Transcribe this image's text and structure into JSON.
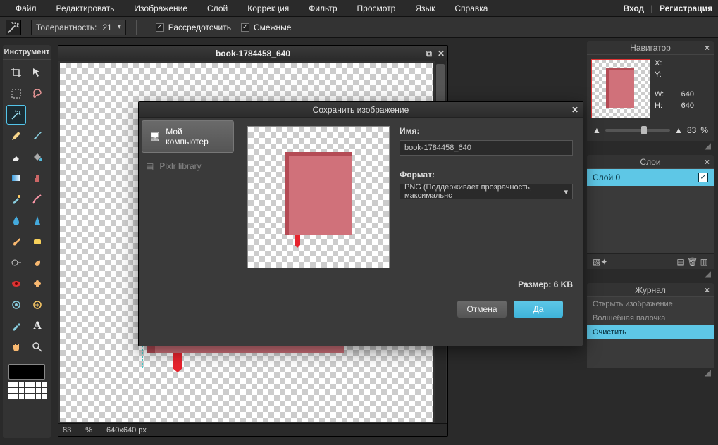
{
  "menu": {
    "items": [
      "Файл",
      "Редактировать",
      "Изображение",
      "Слой",
      "Коррекция",
      "Фильтр",
      "Просмотр",
      "Язык",
      "Справка"
    ],
    "login": "Вход",
    "register": "Регистрация"
  },
  "options": {
    "tolerance_label": "Толерантность:",
    "tolerance_value": "21",
    "anti_alias_label": "Рассредоточить",
    "contiguous_label": "Смежные"
  },
  "toolbox_title": "Инструмент",
  "document": {
    "title": "book-1784458_640",
    "zoom": "83",
    "zoom_unit": "%",
    "dimensions": "640x640 px"
  },
  "navigator": {
    "title": "Навигатор",
    "x_label": "X:",
    "y_label": "Y:",
    "w_label": "W:",
    "h_label": "H:",
    "w_value": "640",
    "h_value": "640",
    "zoom_value": "83",
    "zoom_unit": "%"
  },
  "layers": {
    "title": "Слои",
    "row0": "Слой 0"
  },
  "history": {
    "title": "Журнал",
    "items": [
      "Открыть изображение",
      "Волшебная палочка",
      "Очистить"
    ]
  },
  "dialog": {
    "title": "Сохранить изображение",
    "side": {
      "computer": "Мой компьютер",
      "library": "Pixlr library"
    },
    "name_label": "Имя:",
    "name_value": "book-1784458_640",
    "format_label": "Формат:",
    "format_value": "PNG (Поддерживает прозрачность, максимальнс",
    "size_text": "Размер: 6 KB",
    "cancel": "Отмена",
    "ok": "Да"
  }
}
